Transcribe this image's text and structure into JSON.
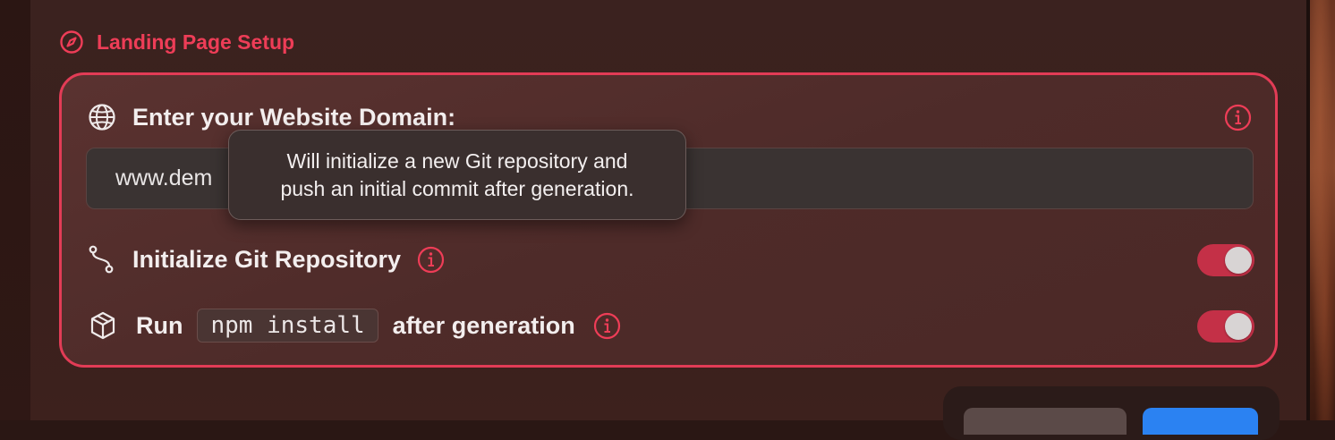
{
  "section": {
    "title": "Landing Page Setup",
    "icon": "compass-icon",
    "accent_color": "#ee3d57"
  },
  "domain": {
    "label": "Enter your Website Domain:",
    "value": "www.dem",
    "icon": "globe-icon",
    "info_icon": "info-icon"
  },
  "git": {
    "label": "Initialize Git Repository",
    "icon": "git-branch-icon",
    "enabled": true
  },
  "npm": {
    "label_prefix": "Run",
    "command": "npm install",
    "label_suffix": "after generation",
    "icon": "package-icon",
    "enabled": true
  },
  "tooltip": {
    "line1": "Will initialize a new Git repository and",
    "line2": "push an initial commit after generation."
  },
  "colors": {
    "toggle_on": "#c43047",
    "primary_button": "#2b82f2"
  }
}
